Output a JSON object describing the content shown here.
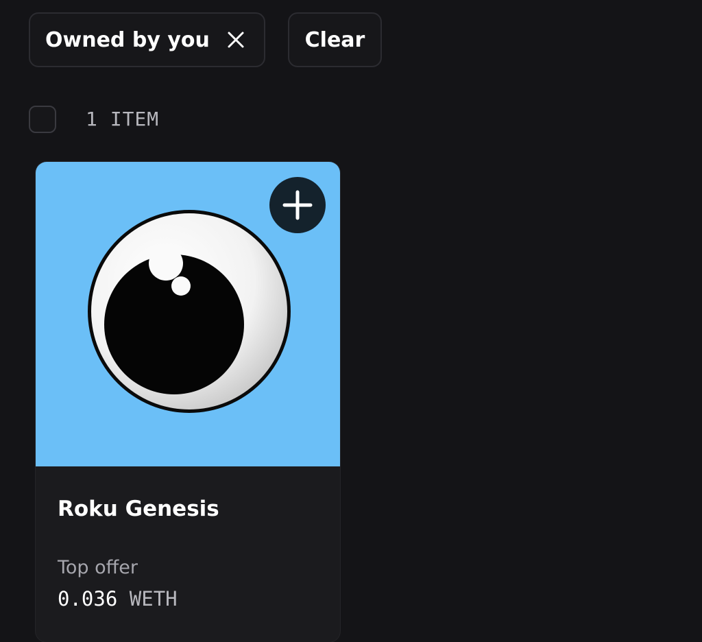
{
  "filters": {
    "active_chip_label": "Owned by you",
    "active_chip_icon": "close-icon",
    "clear_label": "Clear"
  },
  "results": {
    "count_label": "1 ITEM",
    "select_all_checked": false
  },
  "items": [
    {
      "name": "Roku Genesis",
      "image": "cartoon-eyeball",
      "image_background": "#6bbff7",
      "add_icon": "plus-icon",
      "offer_label": "Top offer",
      "offer_amount": "0.036",
      "offer_currency": "WETH"
    }
  ],
  "colors": {
    "background": "#141417",
    "card_body": "#1b1b1e",
    "border": "#2c2c31",
    "muted_text": "#a6a6ad"
  }
}
